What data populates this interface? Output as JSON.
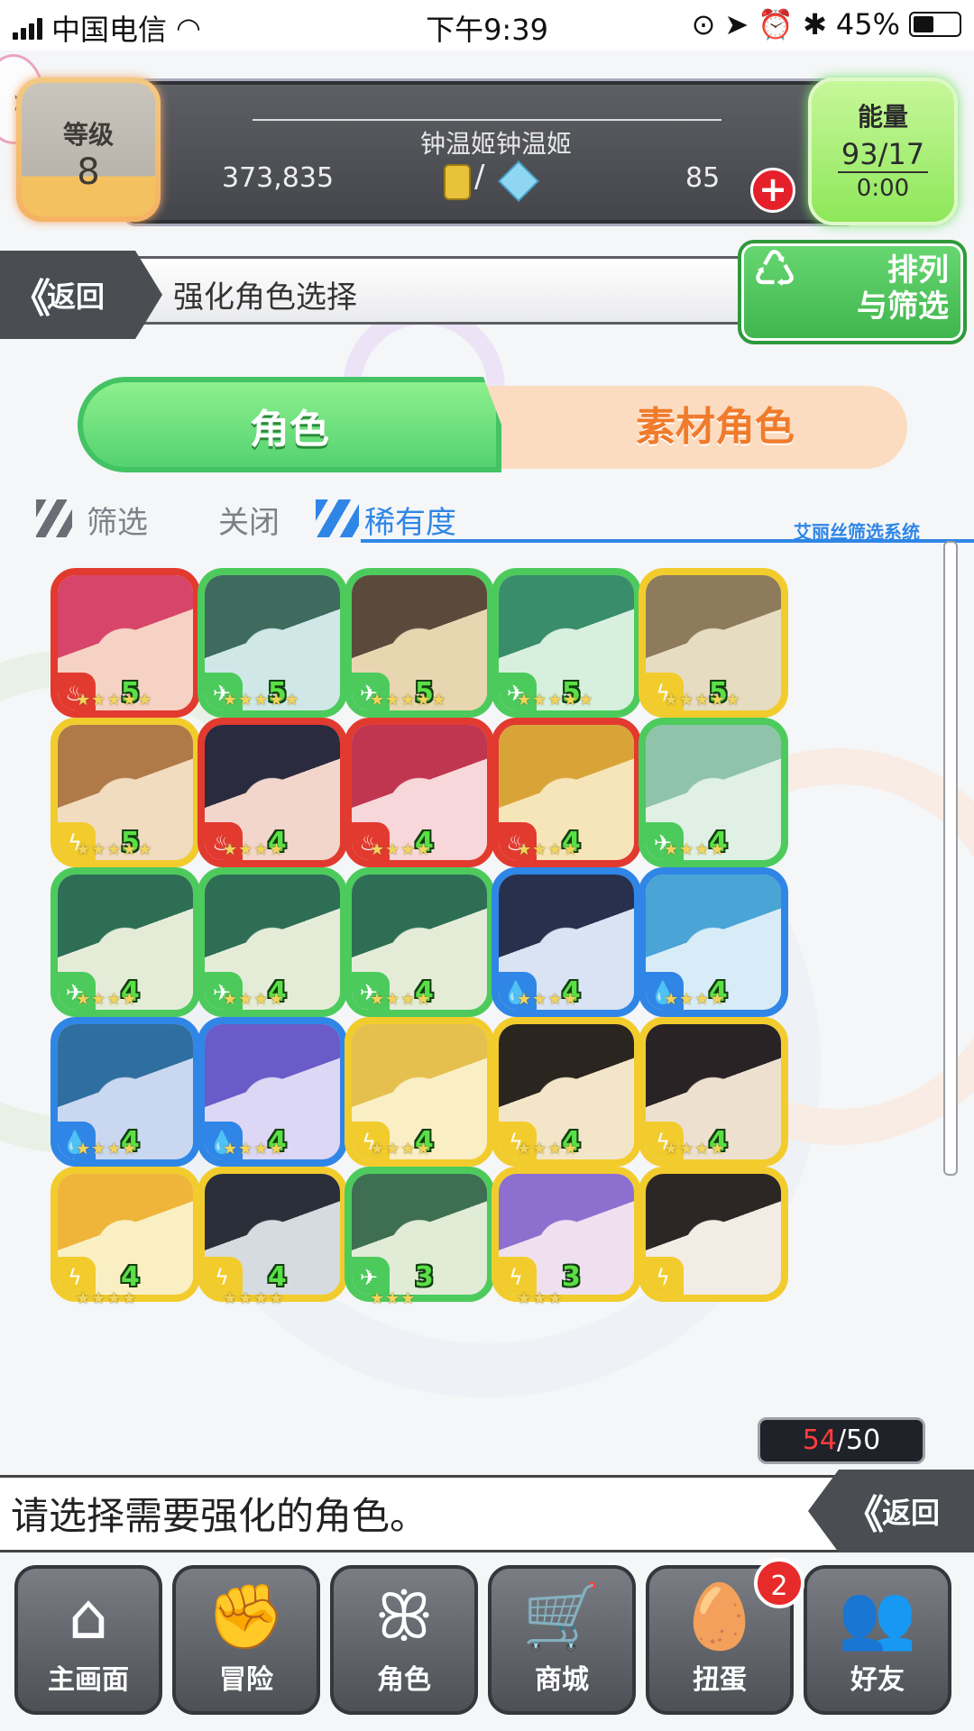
{
  "status_bar": {
    "carrier": "中国电信",
    "time": "下午9:39",
    "battery": "45%"
  },
  "header": {
    "level_label": "等级",
    "level_value": "8",
    "player_name": "钟温姬钟温姬",
    "gold": "373,835",
    "gems": "85",
    "energy_label": "能量",
    "energy_value": "93/17",
    "energy_timer": "0:00"
  },
  "title_bar": {
    "back_label": "返回",
    "title": "强化角色选择",
    "sort_label_1": "排列",
    "sort_label_2": "与筛选"
  },
  "tabs": {
    "characters": "角色",
    "materials": "素材角色"
  },
  "filter": {
    "filter_label": "筛选",
    "filter_state": "关闭",
    "rarity_label": "稀有度",
    "system_label": "艾丽丝筛选系统"
  },
  "characters": [
    {
      "element": "fire",
      "level": "5",
      "stars": "★★★★★"
    },
    {
      "element": "wind",
      "level": "5",
      "stars": "★★★★★"
    },
    {
      "element": "wind",
      "level": "5",
      "stars": "★★★★★"
    },
    {
      "element": "wind",
      "level": "5",
      "stars": "★★★★★"
    },
    {
      "element": "thunder",
      "level": "5",
      "stars": "★★★★★"
    },
    {
      "element": "thunder",
      "level": "5",
      "stars": "★★★★★"
    },
    {
      "element": "fire",
      "level": "4",
      "stars": "★★★★"
    },
    {
      "element": "fire",
      "level": "4",
      "stars": "★★★★"
    },
    {
      "element": "fire",
      "level": "4",
      "stars": "★★★★"
    },
    {
      "element": "wind",
      "level": "4",
      "stars": "★★★★"
    },
    {
      "element": "wind",
      "level": "4",
      "stars": "★★★★"
    },
    {
      "element": "wind",
      "level": "4",
      "stars": "★★★★"
    },
    {
      "element": "wind",
      "level": "4",
      "stars": "★★★★"
    },
    {
      "element": "water",
      "level": "4",
      "stars": "★★★★"
    },
    {
      "element": "water",
      "level": "4",
      "stars": "★★★★"
    },
    {
      "element": "water",
      "level": "4",
      "stars": "★★★★"
    },
    {
      "element": "water",
      "level": "4",
      "stars": "★★★★"
    },
    {
      "element": "thunder",
      "level": "4",
      "stars": "★★★★"
    },
    {
      "element": "thunder",
      "level": "4",
      "stars": "★★★★"
    },
    {
      "element": "thunder",
      "level": "4",
      "stars": "★★★★"
    },
    {
      "element": "thunder",
      "level": "4",
      "stars": "★★★★"
    },
    {
      "element": "thunder",
      "level": "4",
      "stars": "★★★★"
    },
    {
      "element": "wind",
      "level": "3",
      "stars": "★★★"
    },
    {
      "element": "thunder",
      "level": "3",
      "stars": "★★★"
    },
    {
      "element": "thunder",
      "level": "",
      "stars": ""
    }
  ],
  "element_colors": {
    "fire": "#e23a2f",
    "wind": "#4ccb5c",
    "thunder": "#f2cc2d",
    "water": "#2f86e6"
  },
  "count": {
    "current": "54",
    "max": "/50"
  },
  "message": "请选择需要强化的角色。",
  "message_back": "返回",
  "nav": [
    {
      "icon": "home-icon",
      "label": "主画面"
    },
    {
      "icon": "handshake-icon",
      "label": "冒险"
    },
    {
      "icon": "bunny-icon",
      "label": "角色"
    },
    {
      "icon": "cart-icon",
      "label": "商城"
    },
    {
      "icon": "egg-icon",
      "label": "扭蛋"
    },
    {
      "icon": "friends-icon",
      "label": "好友"
    }
  ],
  "gacha_badge": "2"
}
